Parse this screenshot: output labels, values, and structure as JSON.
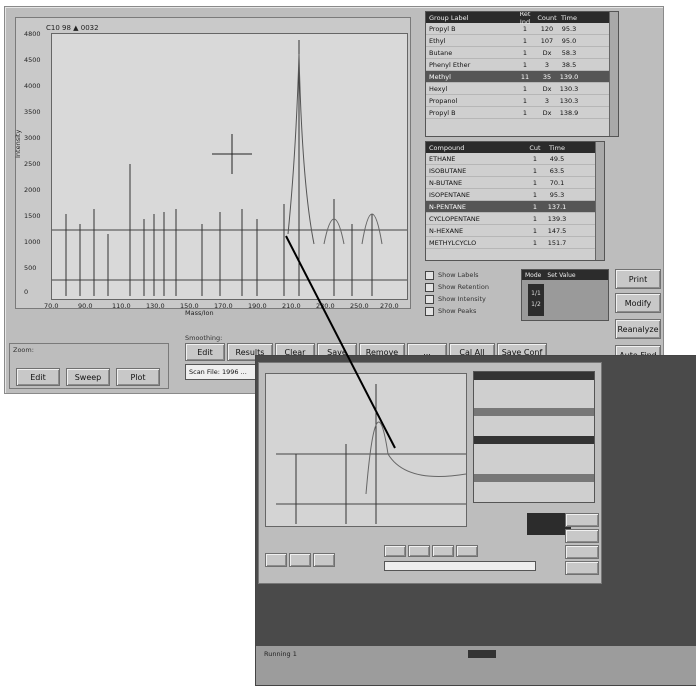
{
  "main_window": {
    "plot": {
      "title": "C10 98 ▲ 0032",
      "ylabel": "Intensity",
      "xlabel": "Mass/Ion",
      "y_ticks": [
        "4800",
        "4500",
        "4000",
        "3500",
        "3000",
        "2500",
        "2000",
        "1500",
        "1000",
        "500",
        "0"
      ],
      "x_ticks": [
        "70.0",
        "90.0",
        "110.0",
        "130.0",
        "150.0",
        "170.0",
        "190.0",
        "210.0",
        "230.0",
        "250.0",
        "270.0"
      ]
    },
    "table1": {
      "headers": [
        "Group Label",
        "Ret Ind",
        "Count",
        "Time"
      ],
      "rows": [
        [
          "Propyl B",
          "1",
          "120",
          "95.3"
        ],
        [
          "Ethyl",
          "1",
          "107",
          "95.0"
        ],
        [
          "Butane",
          "1",
          "Dx",
          "58.3"
        ],
        [
          "Phenyl Ether",
          "1",
          "3",
          "38.5"
        ],
        [
          "Methyl",
          "11",
          "35",
          "139.0"
        ],
        [
          "Hexyl",
          "1",
          "Dx",
          "130.3"
        ],
        [
          "Propanol",
          "1",
          "3",
          "130.3"
        ],
        [
          "Propyl B",
          "1",
          "Dx",
          "138.9"
        ]
      ],
      "selected": 4
    },
    "table2": {
      "headers": [
        "Compound",
        "Cut",
        "Time"
      ],
      "rows": [
        [
          "ETHANE",
          "1",
          "49.5"
        ],
        [
          "ISOBUTANE",
          "1",
          "63.5"
        ],
        [
          "N-BUTANE",
          "1",
          "70.1"
        ],
        [
          "ISOPENTANE",
          "1",
          "95.3"
        ],
        [
          "N-PENTANE",
          "1",
          "137.1"
        ],
        [
          "CYCLOPENTANE",
          "1",
          "139.3"
        ],
        [
          "N-HEXANE",
          "1",
          "147.5"
        ],
        [
          "METHYLCYCLO",
          "1",
          "151.7"
        ]
      ],
      "selected": 4
    },
    "checkbox_labels": [
      "Show Labels",
      "Show Retention",
      "Show Intensity",
      "Show Peaks"
    ],
    "mode_labels": [
      "Mode",
      "Set Value"
    ],
    "mode_small_labels": [
      "1/1",
      "1/2"
    ],
    "right_buttons": [
      "Print",
      "Modify",
      "Reanalyze",
      "Auto Find"
    ],
    "smooth_label": "Smoothing:",
    "stats_buttons": [
      "Edit",
      "Results",
      "Clear",
      "Save",
      "Remove",
      "...",
      "Cal All",
      "Save Conf"
    ],
    "status_field": "Scan File: 1996 ...",
    "zoom_group_label": "Zoom:",
    "zoom_buttons": [
      "Edit",
      "Sweep",
      "Plot"
    ]
  },
  "inset": {
    "status_text": "Running 1"
  },
  "colors": {
    "window_bg": "#bdbdbd",
    "plot_bg": "#d9d9d9",
    "dark": "#2c2c2c",
    "selected_row": "#555555"
  }
}
